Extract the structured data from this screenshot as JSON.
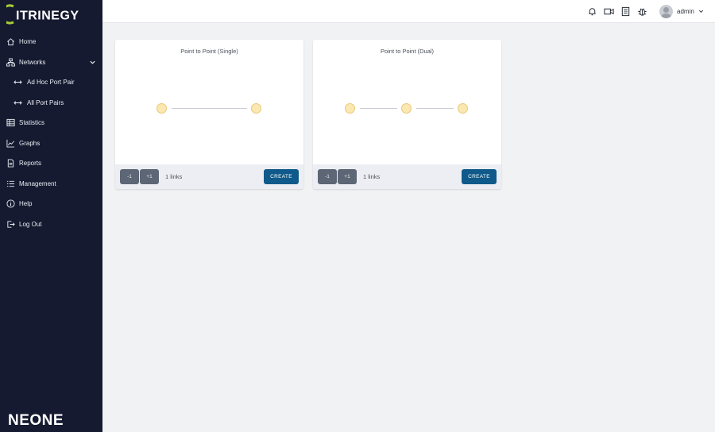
{
  "brand": {
    "name": "ITRINEGY",
    "product": "NEONE"
  },
  "sidebar": {
    "items": [
      {
        "label": "Home",
        "icon": "home-icon"
      },
      {
        "label": "Networks",
        "icon": "network-icon"
      },
      {
        "label": "Ad Hoc Port Pair",
        "icon": "arrows-icon"
      },
      {
        "label": "All Port Pairs",
        "icon": "arrows-icon"
      },
      {
        "label": "Statistics",
        "icon": "table-icon"
      },
      {
        "label": "Graphs",
        "icon": "chart-icon"
      },
      {
        "label": "Reports",
        "icon": "document-icon"
      },
      {
        "label": "Management",
        "icon": "list-icon"
      },
      {
        "label": "Help",
        "icon": "info-icon"
      },
      {
        "label": "Log Out",
        "icon": "logout-icon"
      }
    ]
  },
  "topbar": {
    "user": "admin"
  },
  "cards": [
    {
      "title": "Point to Point (Single)",
      "minus": "-1",
      "plus": "+1",
      "links": "1 links",
      "create": "CREATE"
    },
    {
      "title": "Point to Point (Dual)",
      "minus": "-1",
      "plus": "+1",
      "links": "1 links",
      "create": "CREATE"
    }
  ],
  "colors": {
    "sidebar": "#151a30",
    "accent": "#0f5a8a",
    "brand_green": "#a6ce39",
    "node": "#fbe7b0"
  }
}
